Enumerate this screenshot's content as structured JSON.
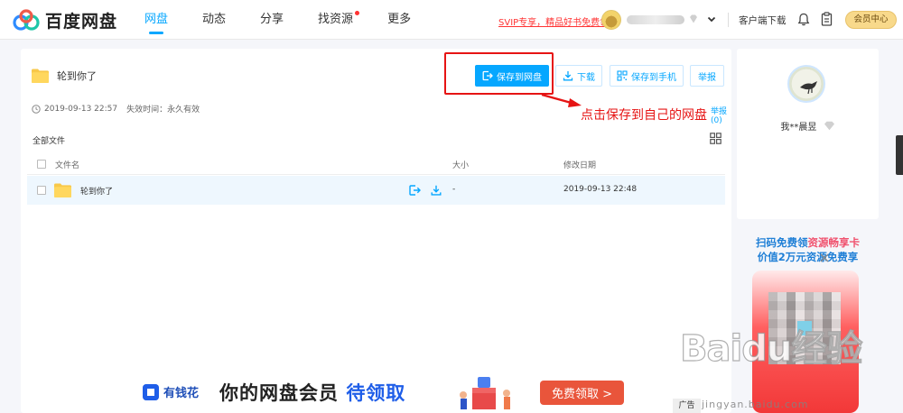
{
  "brand": {
    "name": "百度网盘",
    "logo_icon": "baidu-cloud-logo-icon"
  },
  "nav": {
    "tabs": [
      {
        "label": "网盘",
        "active": true
      },
      {
        "label": "动态",
        "active": false
      },
      {
        "label": "分享",
        "active": false
      },
      {
        "label": "找资源",
        "active": false,
        "badge_dot": true
      },
      {
        "label": "更多",
        "active": false
      }
    ],
    "svip_promo": "SVIP专享，精品好书免费领",
    "client_download": "客户端下载",
    "member_center": "会员中心",
    "icons": [
      "vip-diamond-icon",
      "chevron-down-icon",
      "bell-icon",
      "clipboard-icon"
    ]
  },
  "share": {
    "folder_name": "轮到你了",
    "created": "2019-09-13 22:57",
    "expire_label": "失效时间：永久有效",
    "report_link": "举报",
    "report_suffix": "(0)",
    "all_files": "全部文件",
    "buttons": {
      "save": "保存到网盘",
      "download": "下载",
      "save_phone": "保存到手机",
      "report": "举报"
    }
  },
  "annotation": {
    "text": "点击保存到自己的网盘",
    "color": "#e61414"
  },
  "table": {
    "headers": {
      "name": "文件名",
      "size": "大小",
      "date": "修改日期"
    },
    "rows": [
      {
        "name": "轮到你了",
        "size": "-",
        "date": "2019-09-13 22:48"
      }
    ]
  },
  "ad": {
    "brand": "有钱花",
    "headline_prefix": "你的网盘会员",
    "headline_highlight": "待领取",
    "cta": "免费领取 >",
    "tag": "广告"
  },
  "profile": {
    "name": "我**晨昱"
  },
  "promo": {
    "line1_prefix": "扫码免费领",
    "line1_highlight": "资源畅享卡",
    "line2": "价值2万元资源免费享"
  },
  "watermark": {
    "main": "Baidu经验",
    "sub": "jingyan.baidu.com"
  },
  "colors": {
    "accent": "#06a7ff",
    "annotation": "#e61414",
    "ad_blue": "#1f5ee8",
    "ad_cta": "#e9553b"
  }
}
